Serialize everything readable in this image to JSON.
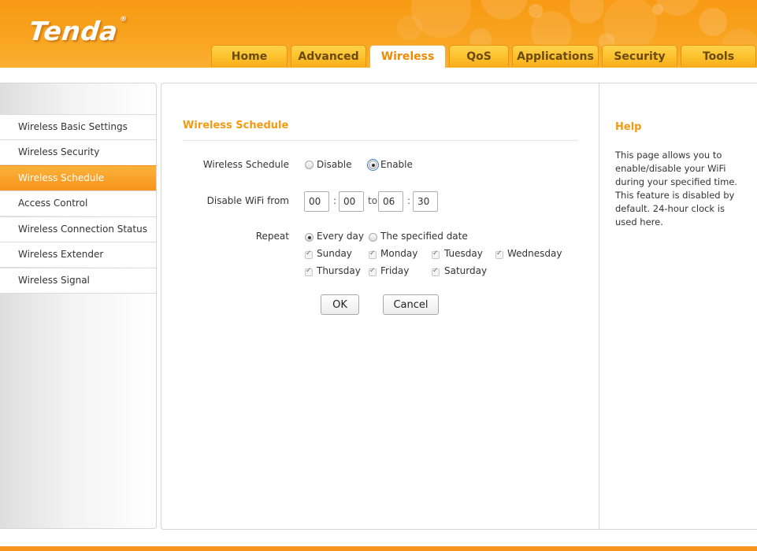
{
  "header": {
    "logo": "Tenda",
    "logo_mark": "®",
    "tabs": [
      {
        "label": "Home",
        "active": false
      },
      {
        "label": "Advanced",
        "active": false
      },
      {
        "label": "Wireless",
        "active": true
      },
      {
        "label": "QoS",
        "active": false
      },
      {
        "label": "Applications",
        "active": false
      },
      {
        "label": "Security",
        "active": false
      },
      {
        "label": "Tools",
        "active": false
      }
    ]
  },
  "sidebar": {
    "items": [
      {
        "label": "Wireless Basic Settings",
        "active": false
      },
      {
        "label": "Wireless Security",
        "active": false
      },
      {
        "label": "Wireless Schedule",
        "active": true
      },
      {
        "label": "Access Control",
        "active": false
      },
      {
        "label": "Wireless Connection Status",
        "active": false
      },
      {
        "label": "Wireless Extender",
        "active": false
      },
      {
        "label": "Wireless Signal",
        "active": false
      }
    ]
  },
  "main": {
    "title": "Wireless Schedule",
    "schedule": {
      "label": "Wireless Schedule",
      "options": [
        "Disable",
        "Enable"
      ],
      "selected": "Enable"
    },
    "disable_from": {
      "label": "Disable WiFi from",
      "start_hour": "00",
      "start_minute": "00",
      "to_label": "to",
      "end_hour": "06",
      "end_minute": "30",
      "colon": ":"
    },
    "repeat": {
      "label": "Repeat",
      "options": [
        "Every day",
        "The specified date"
      ],
      "selected": "Every day",
      "days": [
        {
          "label": "Sunday",
          "checked": true
        },
        {
          "label": "Monday",
          "checked": true
        },
        {
          "label": "Tuesday",
          "checked": true
        },
        {
          "label": "Wednesday",
          "checked": true
        },
        {
          "label": "Thursday",
          "checked": true
        },
        {
          "label": "Friday",
          "checked": true
        },
        {
          "label": "Saturday",
          "checked": true
        }
      ]
    },
    "buttons": {
      "ok": "OK",
      "cancel": "Cancel"
    }
  },
  "help": {
    "title": "Help",
    "text": "This page allows you to enable/disable your WiFi during your specified time. This feature is disabled by default. 24-hour clock is used here."
  },
  "colors": {
    "accent": "#f39a12",
    "header_orange": "#f99a14",
    "active_nav": "#f7941d"
  }
}
